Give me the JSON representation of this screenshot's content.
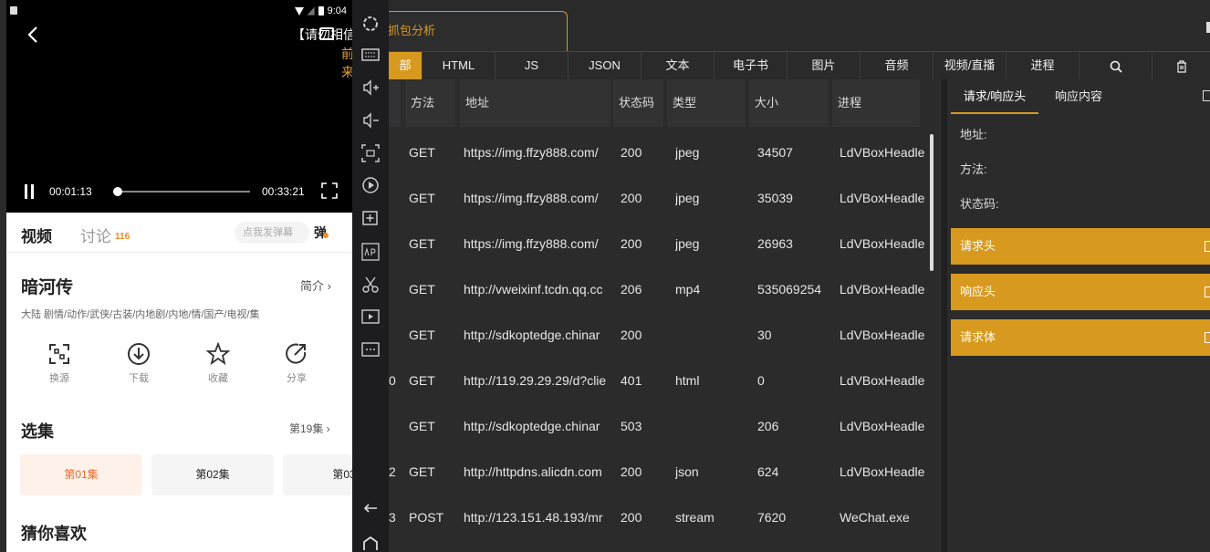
{
  "phone": {
    "status_time": "9:04",
    "video_title": "【请勿相信",
    "overlay_text": [
      "前",
      "来"
    ],
    "time_current": "00:01:13",
    "time_total": "00:33:21",
    "progress_fraction": 0.036,
    "tab_video": "视频",
    "tab_discuss": "讨论",
    "discuss_count": "116",
    "danmu_placeholder": "点我发弹幕",
    "danmu_btn": "弹",
    "show_title": "暗河传",
    "intro_link": "简介 ›",
    "show_tags": "大陆  剧情/动作/武侠/古装/内地剧/内地/情/国产/电视/集",
    "actions": [
      {
        "label": "换源",
        "icon": "switch-source-icon"
      },
      {
        "label": "下载",
        "icon": "download-icon"
      },
      {
        "label": "收藏",
        "icon": "star-icon"
      },
      {
        "label": "分享",
        "icon": "share-icon"
      }
    ],
    "episodes_title": "选集",
    "episode_count": "第19集 ›",
    "episodes": [
      "第01集",
      "第02集",
      "第03"
    ],
    "guess_title": "猜你喜欢"
  },
  "sniffer": {
    "active_tab": "抓包分析",
    "filters": [
      "部",
      "HTML",
      "JS",
      "JSON",
      "文本",
      "电子书",
      "图片",
      "音频",
      "视频/直播",
      "进程"
    ],
    "columns": [
      "方法",
      "地址",
      "状态码",
      "类型",
      "大小",
      "进程"
    ],
    "rows": [
      {
        "index": "",
        "method": "GET",
        "url": "https://img.ffzy888.com/",
        "status": "200",
        "type": "jpeg",
        "size": "34507",
        "process": "LdVBoxHeadle"
      },
      {
        "index": "",
        "method": "GET",
        "url": "https://img.ffzy888.com/",
        "status": "200",
        "type": "jpeg",
        "size": "35039",
        "process": "LdVBoxHeadle"
      },
      {
        "index": "",
        "method": "GET",
        "url": "https://img.ffzy888.com/",
        "status": "200",
        "type": "jpeg",
        "size": "26963",
        "process": "LdVBoxHeadle"
      },
      {
        "index": "",
        "method": "GET",
        "url": "http://vweixinf.tcdn.qq.cc",
        "status": "206",
        "type": "mp4",
        "size": "535069254",
        "process": "LdVBoxHeadle"
      },
      {
        "index": "",
        "method": "GET",
        "url": "http://sdkoptedge.chinar",
        "status": "200",
        "type": "",
        "size": "30",
        "process": "LdVBoxHeadle"
      },
      {
        "index": "0",
        "method": "GET",
        "url": "http://119.29.29.29/d?clie",
        "status": "401",
        "type": "html",
        "size": "0",
        "process": "LdVBoxHeadle"
      },
      {
        "index": "",
        "method": "GET",
        "url": "http://sdkoptedge.chinar",
        "status": "503",
        "type": "",
        "size": "206",
        "process": "LdVBoxHeadle"
      },
      {
        "index": "2",
        "method": "GET",
        "url": "http://httpdns.alicdn.com",
        "status": "200",
        "type": "json",
        "size": "624",
        "process": "LdVBoxHeadle"
      },
      {
        "index": "3",
        "method": "POST",
        "url": "http://123.151.48.193/mr",
        "status": "200",
        "type": "stream",
        "size": "7620",
        "process": "WeChat.exe"
      }
    ],
    "detail": {
      "tab_req": "请求/响应头",
      "tab_resp": "响应内容",
      "fields": [
        "地址:",
        "方法:",
        "状态码:"
      ],
      "sections": [
        "请求头",
        "响应头",
        "请求体"
      ]
    }
  },
  "colors": {
    "accent": "#d79a1f",
    "phone_highlight": "#ea6a2a",
    "dark_bg": "#2a2a2a"
  }
}
